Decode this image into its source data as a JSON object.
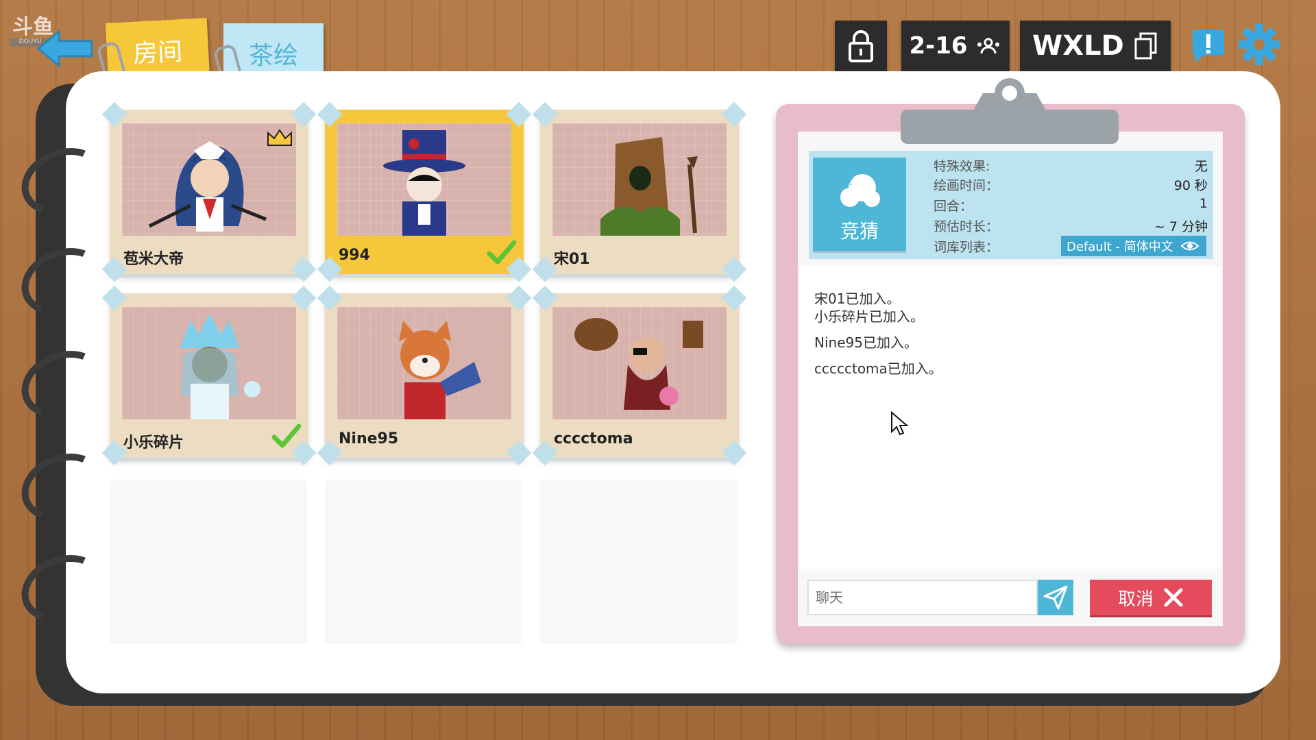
{
  "watermark": {
    "logo": "斗鱼",
    "sub": "DOUYU"
  },
  "tabs": [
    {
      "label": "房间",
      "active": true
    },
    {
      "label": "茶绘",
      "active": false
    }
  ],
  "header": {
    "player_range": "2-16",
    "room_code": "WXLD"
  },
  "icons": {
    "back": "arrow-left-icon",
    "lock": "lock-icon",
    "people": "people-icon",
    "copy": "copy-icon",
    "report": "exclamation-icon",
    "settings": "gear-icon",
    "crown": "crown-icon",
    "check": "checkmark-icon",
    "send": "paper-plane-icon",
    "close": "x-icon",
    "eye": "eye-icon"
  },
  "colors": {
    "accent_yellow": "#f6c73a",
    "accent_blue": "#4eb6d6",
    "cancel_red": "#e44b5d",
    "board_pink": "#e8bccb",
    "check_green": "#5ec436"
  },
  "players": [
    {
      "name": "苞米大帝",
      "host": true,
      "ready": false
    },
    {
      "name": "994",
      "host": false,
      "ready": true
    },
    {
      "name": "宋01",
      "host": false,
      "ready": false
    },
    {
      "name": "小乐碎片",
      "host": false,
      "ready": true
    },
    {
      "name": "Nine95",
      "host": false,
      "ready": false
    },
    {
      "name": "cccctoma",
      "host": false,
      "ready": false
    }
  ],
  "game_mode": {
    "label": "竞猜"
  },
  "settings_info": {
    "effects": {
      "key": "特殊效果:",
      "value": "无"
    },
    "draw_time": {
      "key": "绘画时间：",
      "value": "90 秒"
    },
    "rounds": {
      "key": "回合：",
      "value": "1"
    },
    "est_duration": {
      "key": "预估时长：",
      "value": "~ 7 分钟"
    },
    "word_list": {
      "key": "词库列表：",
      "value": "Default - 简体中文"
    }
  },
  "log": [
    "宋01已加入。",
    "小乐碎片已加入。",
    "Nine95已加入。",
    "ccccctoma已加入。"
  ],
  "chat": {
    "placeholder": "聊天"
  },
  "cancel": {
    "label": "取消"
  }
}
